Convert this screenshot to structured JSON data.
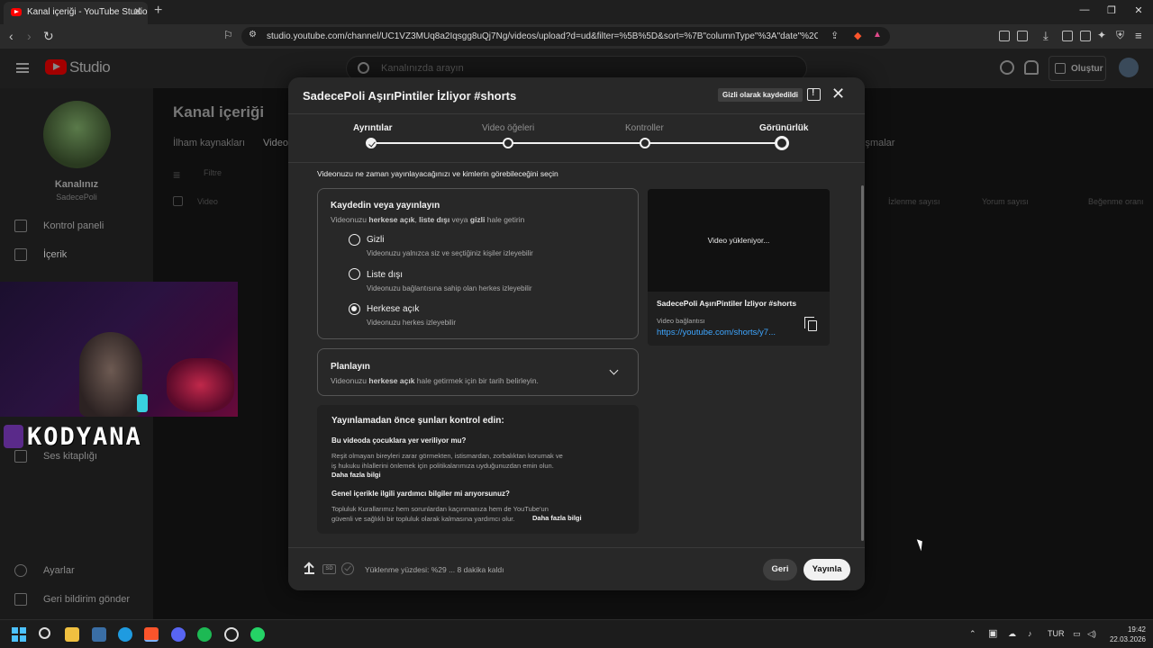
{
  "browser": {
    "tab_title": "Kanal içeriği - YouTube Studio",
    "url": "studio.youtube.com/channel/UC1VZ3MUq8a2Iqsgg8uQj7Ng/videos/upload?d=ud&filter=%5B%5D&sort=%7B\"columnType\"%3A\"date\"%2C\"sortOrd..."
  },
  "studio_header": {
    "logo_text": "Studio",
    "search_placeholder": "Kanalınızda arayın",
    "create_label": "Oluştur"
  },
  "sidebar": {
    "channel_label": "Kanalınız",
    "channel_name": "SadecePoli",
    "items": [
      {
        "label": "Kontrol paneli"
      },
      {
        "label": "İçerik"
      },
      {
        "label": "Ses kitaplığı"
      },
      {
        "label": "Ayarlar"
      },
      {
        "label": "Geri bildirim gönder"
      }
    ]
  },
  "page": {
    "title": "Kanal içeriği",
    "tabs": [
      "İlham kaynakları",
      "Video",
      "işmalar"
    ],
    "filter_label": "Filtre",
    "columns": [
      "Video",
      "İzlenme sayısı",
      "Yorum sayısı",
      "Beğenme oranı"
    ]
  },
  "overlay": {
    "brand_text": "KODYANA"
  },
  "modal": {
    "title": "SadecePoli AşırıPintiler İzliyor #shorts",
    "saved_badge": "Gizli olarak kaydedildi",
    "steps": [
      {
        "label": "Ayrıntılar",
        "state": "done"
      },
      {
        "label": "Video öğeleri",
        "state": "pending"
      },
      {
        "label": "Kontroller",
        "state": "pending"
      },
      {
        "label": "Görünürlük",
        "state": "current"
      }
    ],
    "instruction": "Videonuzu ne zaman yayınlayacağınızı ve kimlerin görebileceğini seçin",
    "save_publish": {
      "title": "Kaydedin veya yayınlayın",
      "subtitle_pre": "Videonuzu ",
      "subtitle_b1": "herkese açık",
      "subtitle_mid1": ", ",
      "subtitle_b2": "liste dışı",
      "subtitle_mid2": " veya ",
      "subtitle_b3": "gizli",
      "subtitle_post": " hale getirin",
      "options": [
        {
          "label": "Gizli",
          "desc": "Videonuzu yalnızca siz ve seçtiğiniz kişiler izleyebilir",
          "selected": false
        },
        {
          "label": "Liste dışı",
          "desc": "Videonuzu bağlantısına sahip olan herkes izleyebilir",
          "selected": false
        },
        {
          "label": "Herkese açık",
          "desc": "Videonuzu herkes izleyebilir",
          "selected": true
        }
      ]
    },
    "schedule": {
      "title": "Planlayın",
      "subtitle_pre": "Videonuzu ",
      "subtitle_b": "herkese açık",
      "subtitle_post": " hale getirmek için bir tarih belirleyin."
    },
    "checklist": {
      "heading": "Yayınlamadan önce şunları kontrol edin:",
      "q1": "Bu videoda çocuklara yer veriliyor mu?",
      "p1_line1": "Reşit olmayan bireyleri zarar görmekten, istismardan, zorbalıktan korumak ve",
      "p1_line2": "iş hukuku ihlallerini önlemek için politikalarımıza uyduğunuzdan emin olun.",
      "link1": "Daha fazla bilgi",
      "q2": "Genel içerikle ilgili yardımcı bilgiler mi arıyorsunuz?",
      "p2_line1": "Topluluk Kurallarımız hem sorunlardan kaçınmanıza hem de YouTube'un",
      "p2_line2": "güvenli ve sağlıklı bir topluluk olarak kalmasına yardımcı olur.",
      "link2": "Daha fazla bilgi"
    },
    "preview": {
      "status": "Video yükleniyor...",
      "title": "SadecePoli AşırıPintiler İzliyor #shorts",
      "link_label": "Video bağlantısı",
      "link": "https://youtube.com/shorts/y7..."
    },
    "footer": {
      "sd_label": "SD",
      "progress_text": "Yüklenme yüzdesi: %29 ... 8 dakika kaldı",
      "progress_percent": 29,
      "back_label": "Geri",
      "publish_label": "Yayınla"
    }
  },
  "taskbar": {
    "lang": "TUR",
    "time": "19:42",
    "date": "22.03.2026"
  }
}
